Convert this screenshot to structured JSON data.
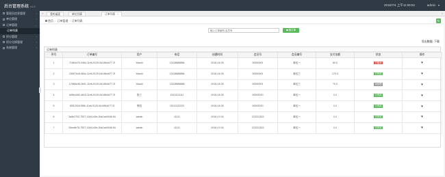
{
  "topbar": {
    "title": "后台管理系统",
    "version": "v1.0",
    "datetime": "2016/7/4 上午11:06:52",
    "user": "admin",
    "user_caret": "▾"
  },
  "sidebar": {
    "items": [
      {
        "label": "管理员信息管理",
        "arrow": "‹"
      },
      {
        "label": "单位管理",
        "arrow": "‹"
      },
      {
        "label": "订单管理",
        "arrow": "⌄"
      },
      {
        "label": "订单列表",
        "sub": true,
        "active": true
      },
      {
        "label": "积分管理",
        "arrow": "‹"
      },
      {
        "label": "积分兑换管理",
        "arrow": "‹"
      },
      {
        "label": "系统管理",
        "arrow": "‹"
      }
    ],
    "collapse_glyph": "‹"
  },
  "tabs": {
    "left_arrow": "«",
    "right_arrow": "»",
    "items": [
      {
        "label": "我的桌面",
        "closable": false
      },
      {
        "label": "单位列表",
        "closable": false
      },
      {
        "label": "订单列表",
        "closable": true,
        "active": true
      }
    ],
    "close_glyph": "×"
  },
  "breadcrumb": {
    "home": "首页",
    "level1": "订单管理",
    "level2": "订单列表",
    "separator": "›",
    "refresh_glyph": "↻"
  },
  "search": {
    "placeholder": "输入订单编号,会员号",
    "button_label": "搜订单"
  },
  "export_label": "导出数据: 下载",
  "panel_title": "订单列表",
  "table": {
    "columns": [
      "序号",
      "订单编号",
      "用户",
      "电话",
      "创建时间",
      "会员号",
      "会员编号",
      "支付金额",
      "状态",
      "操作"
    ],
    "rows": [
      [
        "1",
        "71864c75-0464-11e6-9125-0d14fb4d77 2f",
        "Yasuki",
        "13108888888",
        "2016-04-05",
        "00000001",
        "单位一",
        "80.0",
        "已取消",
        "▼"
      ],
      [
        "2",
        "23507ec8-984c-11e6-9125-0d14fb4d77 2f",
        "Yasuki",
        "13108888888",
        "2016-04-05",
        "00000001",
        "单位三",
        "170.0",
        "已完成",
        "▼"
      ],
      [
        "3",
        "17686e46-2b91-11e6-9125-0d14fb4d77 2f",
        "Yasuki",
        "13108888888",
        "2016-04-05",
        "00000001",
        "单位三",
        "70.0",
        "待处理",
        "▼"
      ],
      [
        "4",
        "d45ec4b5-4b16-11e6-9125-0d14fb4d77 2f",
        "张三",
        "15111111111",
        "2016-04-05",
        "00002020",
        "单位一",
        "0.0",
        "已完成",
        "▼"
      ],
      [
        "5",
        "50f1202d-9f6b-11e6-9125-0d14fb4d77 2f",
        "李四",
        "15111122222",
        "2016-04-05",
        "00002020",
        "单位一",
        "0.0",
        "已完成",
        "▼"
      ],
      [
        "6",
        "3a5e2702-7527-11e6-b2fe-54e1ad3948 84",
        "admin",
        "11111",
        "2016-07-04",
        "123213322",
        "单位一",
        "0.0",
        "已完成",
        "▼"
      ],
      [
        "7",
        "29ee8b76-7527-11e6-b2fe-54e1ad3948 84",
        "admin",
        "11111",
        "2016-07-04",
        "123213322",
        "单位一",
        "0.0",
        "已完成",
        "▼"
      ]
    ],
    "status_colors": {
      "已取消": "red",
      "已完成": "green",
      "待处理": "gray"
    }
  },
  "colors": {
    "sidebar_bg": "#2f3a45",
    "accent_green": "#5cb85c",
    "danger_red": "#d9534f"
  }
}
